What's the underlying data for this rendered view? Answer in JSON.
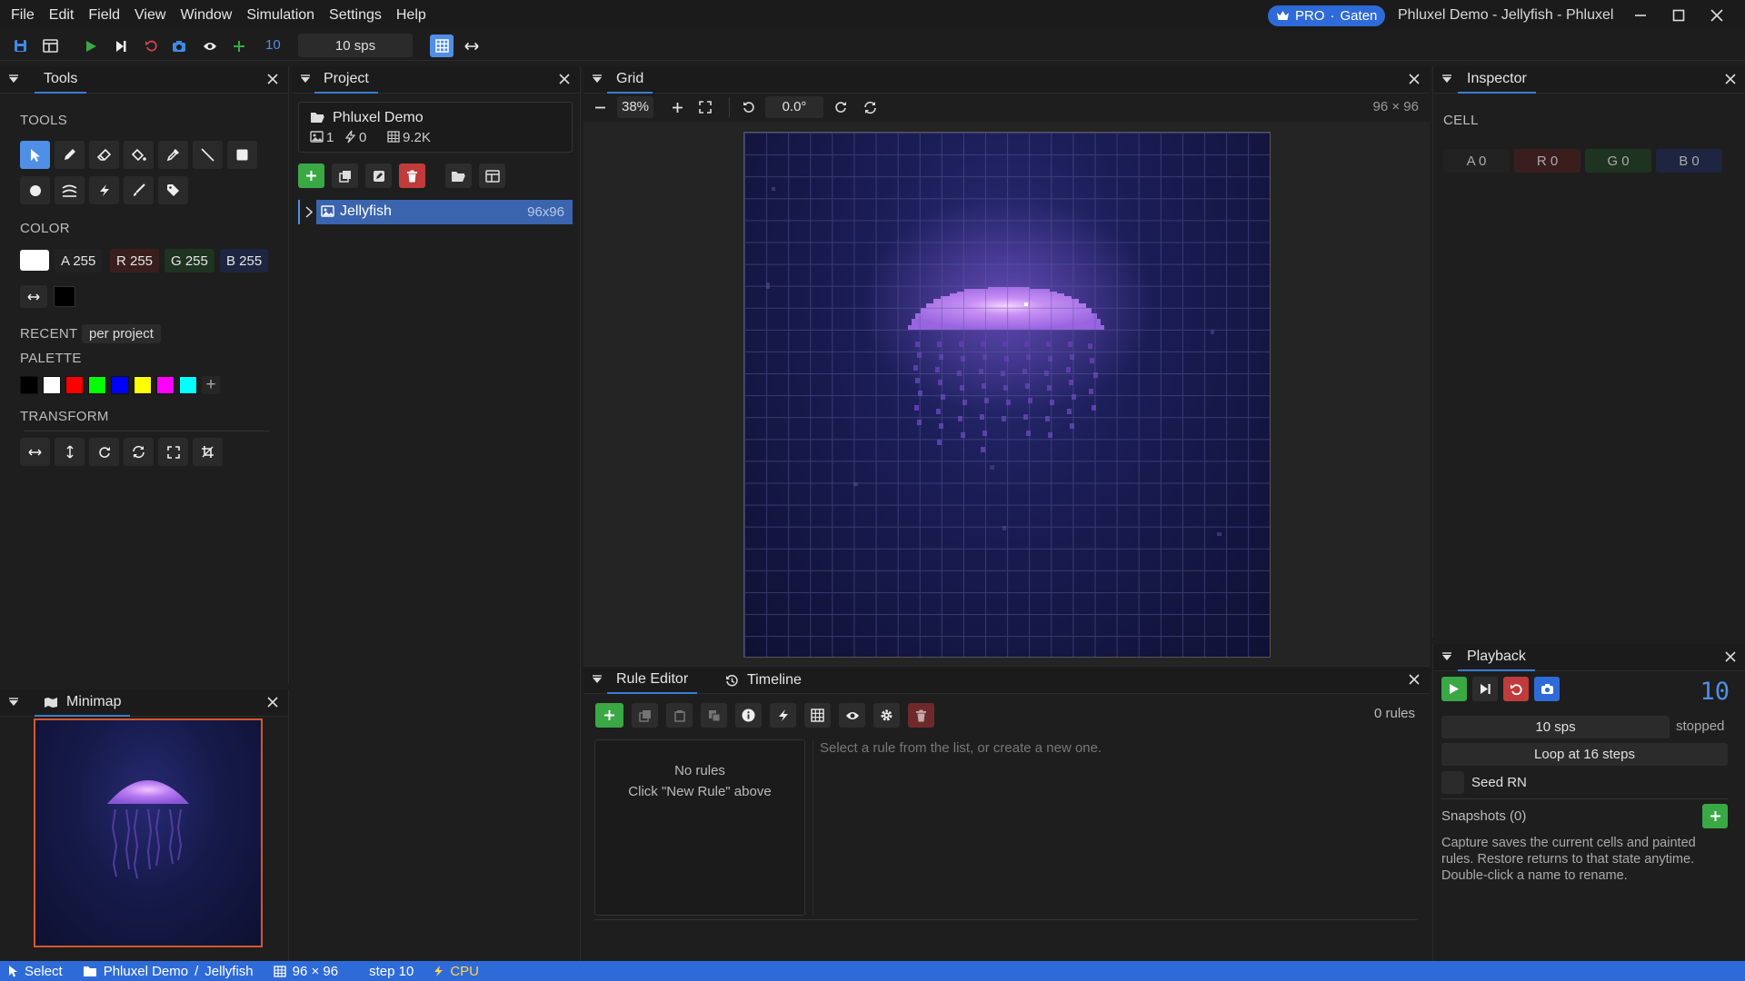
{
  "menu": [
    "File",
    "Edit",
    "Field",
    "View",
    "Window",
    "Simulation",
    "Settings",
    "Help"
  ],
  "pro_badge": {
    "tier": "PRO",
    "dot": "·",
    "user": "Gaten"
  },
  "window_title": "Phluxel Demo - Jellyfish - Phluxel",
  "toolbar": {
    "step_count": "10",
    "speed": "10 sps"
  },
  "tools_panel": {
    "tab": "Tools",
    "tools_heading": "TOOLS",
    "color_heading": "COLOR",
    "color_channels": {
      "a": "A 255",
      "r": "R 255",
      "g": "G 255",
      "b": "B 255"
    },
    "recent_label": "RECENT",
    "recent_scope": "per project",
    "palette_heading": "PALETTE",
    "palette": [
      "#000000",
      "#ffffff",
      "#ff0000",
      "#00ff00",
      "#0000ff",
      "#ffff00",
      "#ff00ff",
      "#00ffff"
    ],
    "palette_add": "+",
    "transform_heading": "TRANSFORM"
  },
  "minimap": {
    "tab": "Minimap"
  },
  "project_panel": {
    "tab": "Project",
    "name": "Phluxel Demo",
    "images": "1",
    "rules": "0",
    "cells": "9.2K",
    "field_name": "Jellyfish",
    "field_size": "96x96"
  },
  "grid_panel": {
    "tab": "Grid",
    "zoom": "38%",
    "rotation": "0.0°",
    "size": "96 × 96"
  },
  "inspector": {
    "tab": "Inspector",
    "cell_heading": "CELL",
    "channels": {
      "a": "A 0",
      "r": "R 0",
      "g": "G 0",
      "b": "B 0"
    }
  },
  "rule_editor": {
    "tab": "Rule Editor",
    "timeline_tab": "Timeline",
    "count": "0 rules",
    "empty_title": "No rules",
    "empty_hint": "Click \"New Rule\" above",
    "detail_hint": "Select a rule from the list, or create a new one."
  },
  "playback": {
    "tab": "Playback",
    "step": "10",
    "speed": "10 sps",
    "state": "stopped",
    "loop": "Loop at 16 steps",
    "seed": "Seed RN",
    "snapshots": "Snapshots (0)",
    "help": "Capture saves the current cells and painted rules. Restore returns to that state anytime. Double-click a name to rename."
  },
  "status": {
    "tool": "Select",
    "project": "Phluxel Demo",
    "sep": "/",
    "field": "Jellyfish",
    "size": "96 × 96",
    "step": "step 10",
    "backend": "CPU"
  },
  "colors": {
    "accent": "#2f6bd8",
    "active_tool": "#4f8fe6",
    "green": "#3aa845",
    "red": "#c03b3b",
    "canvas_bg": "#12133a"
  }
}
